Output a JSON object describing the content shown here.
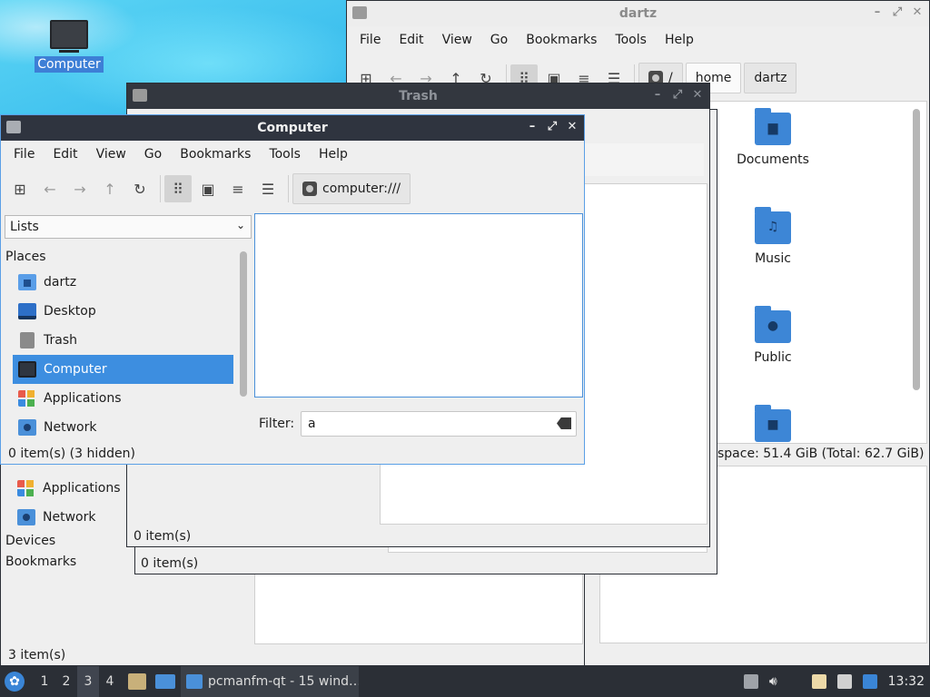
{
  "desktop": {
    "computer_icon_label": "Computer"
  },
  "menus": [
    "File",
    "Edit",
    "View",
    "Go",
    "Bookmarks",
    "Tools",
    "Help"
  ],
  "dartz_window": {
    "title": "dartz",
    "path": [
      "/",
      "home",
      "dartz"
    ],
    "folders": [
      {
        "label": "Documents",
        "icon": "document-folder-icon"
      },
      {
        "label": "Music",
        "icon": "music-folder-icon"
      },
      {
        "label": "Public",
        "icon": "public-folder-icon"
      },
      {
        "label": "",
        "icon": "videos-folder-icon"
      }
    ],
    "status": "space: 51.4 GiB (Total: 62.7 GiB)",
    "sidebar_under": {
      "items": [
        "Applications",
        "Network"
      ],
      "sections": [
        "Devices",
        "Bookmarks"
      ],
      "status": "3 item(s)"
    }
  },
  "trash_window": {
    "title": "Trash",
    "status": "0 item(s)",
    "status_behind": "0 item(s)"
  },
  "computer_window": {
    "title": "Computer",
    "location": "computer:///",
    "sidebar_mode": "Lists",
    "places_header": "Places",
    "places": [
      {
        "label": "dartz",
        "icon": "home-folder-icon",
        "selected": false
      },
      {
        "label": "Desktop",
        "icon": "desktop-icon",
        "selected": false
      },
      {
        "label": "Trash",
        "icon": "trash-icon",
        "selected": false
      },
      {
        "label": "Computer",
        "icon": "computer-icon",
        "selected": true
      },
      {
        "label": "Applications",
        "icon": "applications-icon",
        "selected": false
      },
      {
        "label": "Network",
        "icon": "network-icon",
        "selected": false
      }
    ],
    "filter_label": "Filter:",
    "filter_value": "a",
    "status": "0 item(s) (3 hidden)"
  },
  "taskbar": {
    "workspaces": [
      "1",
      "2",
      "3",
      "4"
    ],
    "current_workspace": "3",
    "task_label": "pcmanfm-qt - 15 wind…",
    "clock": "13:32"
  }
}
